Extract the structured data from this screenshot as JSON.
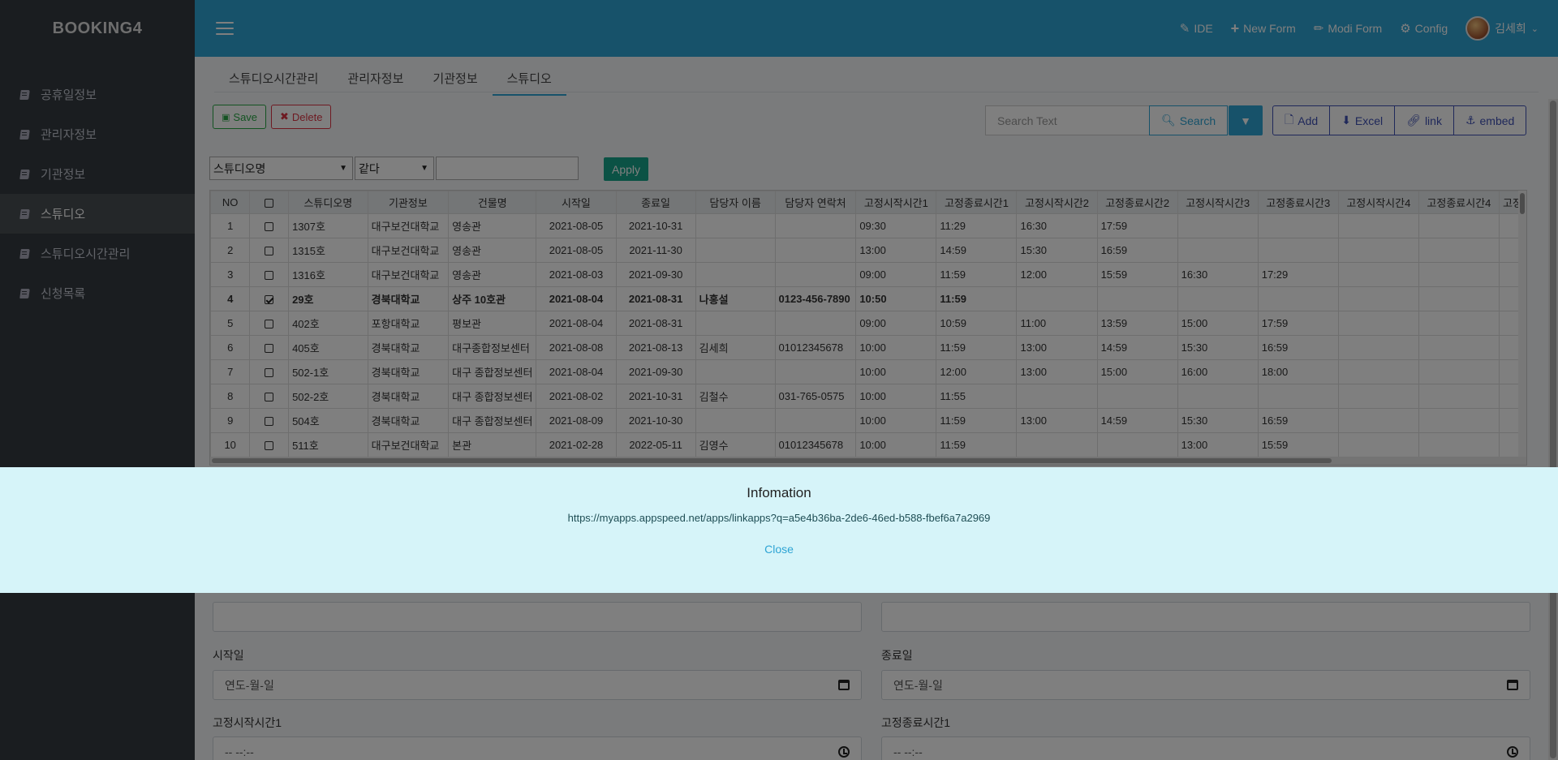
{
  "brand": "BOOKING4",
  "sidebar": {
    "items": [
      {
        "label": "공휴일정보",
        "active": false
      },
      {
        "label": "관리자정보",
        "active": false
      },
      {
        "label": "기관정보",
        "active": false
      },
      {
        "label": "스튜디오",
        "active": true
      },
      {
        "label": "스튜디오시간관리",
        "active": false
      },
      {
        "label": "신청목록",
        "active": false
      }
    ]
  },
  "topbar": {
    "ide": "IDE",
    "new_form": "New Form",
    "modi_form": "Modi Form",
    "config": "Config",
    "user": "김세희"
  },
  "tabs": [
    "스튜디오시간관리",
    "관리자정보",
    "기관정보",
    "스튜디오"
  ],
  "toolbar": {
    "save": "Save",
    "delete": "Delete",
    "search_placeholder": "Search Text",
    "search": "Search",
    "add": "Add",
    "excel": "Excel",
    "link": "link",
    "embed": "embed"
  },
  "filter": {
    "field": "스튜디오명",
    "operator": "같다",
    "apply": "Apply"
  },
  "grid": {
    "columns": [
      "NO",
      "",
      "스튜디오명",
      "기관정보",
      "건물명",
      "시작일",
      "종료일",
      "담당자 이름",
      "담당자 연락처",
      "고정시작시간1",
      "고정종료시간1",
      "고정시작시간2",
      "고정종료시간2",
      "고정시작시간3",
      "고정종료시간3",
      "고정시작시간4",
      "고정종료시간4",
      "고정"
    ],
    "rows": [
      {
        "no": "1",
        "checked": false,
        "studio": "1307호",
        "org": "대구보건대학교",
        "bldg": "영송관",
        "start": "2021-08-05",
        "end": "2021-10-31",
        "mgr": "",
        "phone": "",
        "s1": "09:30",
        "e1": "11:29",
        "s2": "16:30",
        "e2": "17:59",
        "s3": "",
        "e3": "",
        "s4": "",
        "e4": ""
      },
      {
        "no": "2",
        "checked": false,
        "studio": "1315호",
        "org": "대구보건대학교",
        "bldg": "영송관",
        "start": "2021-08-05",
        "end": "2021-11-30",
        "mgr": "",
        "phone": "",
        "s1": "13:00",
        "e1": "14:59",
        "s2": "15:30",
        "e2": "16:59",
        "s3": "",
        "e3": "",
        "s4": "",
        "e4": ""
      },
      {
        "no": "3",
        "checked": false,
        "studio": "1316호",
        "org": "대구보건대학교",
        "bldg": "영송관",
        "start": "2021-08-03",
        "end": "2021-09-30",
        "mgr": "",
        "phone": "",
        "s1": "09:00",
        "e1": "11:59",
        "s2": "12:00",
        "e2": "15:59",
        "s3": "16:30",
        "e3": "17:29",
        "s4": "",
        "e4": ""
      },
      {
        "no": "4",
        "checked": true,
        "studio": "29호",
        "org": "경북대학교",
        "bldg": "상주 10호관",
        "start": "2021-08-04",
        "end": "2021-08-31",
        "mgr": "나홍설",
        "phone": "0123-456-7890",
        "s1": "10:50",
        "e1": "11:59",
        "s2": "",
        "e2": "",
        "s3": "",
        "e3": "",
        "s4": "",
        "e4": ""
      },
      {
        "no": "5",
        "checked": false,
        "studio": "402호",
        "org": "포항대학교",
        "bldg": "평보관",
        "start": "2021-08-04",
        "end": "2021-08-31",
        "mgr": "",
        "phone": "",
        "s1": "09:00",
        "e1": "10:59",
        "s2": "11:00",
        "e2": "13:59",
        "s3": "15:00",
        "e3": "17:59",
        "s4": "",
        "e4": ""
      },
      {
        "no": "6",
        "checked": false,
        "studio": "405호",
        "org": "경북대학교",
        "bldg": "대구종합정보센터",
        "start": "2021-08-08",
        "end": "2021-08-13",
        "mgr": "김세희",
        "phone": "01012345678",
        "s1": "10:00",
        "e1": "11:59",
        "s2": "13:00",
        "e2": "14:59",
        "s3": "15:30",
        "e3": "16:59",
        "s4": "",
        "e4": ""
      },
      {
        "no": "7",
        "checked": false,
        "studio": "502-1호",
        "org": "경북대학교",
        "bldg": "대구 종합정보센터",
        "start": "2021-08-04",
        "end": "2021-09-30",
        "mgr": "",
        "phone": "",
        "s1": "10:00",
        "e1": "12:00",
        "s2": "13:00",
        "e2": "15:00",
        "s3": "16:00",
        "e3": "18:00",
        "s4": "",
        "e4": ""
      },
      {
        "no": "8",
        "checked": false,
        "studio": "502-2호",
        "org": "경북대학교",
        "bldg": "대구 종합정보센터",
        "start": "2021-08-02",
        "end": "2021-10-31",
        "mgr": "김철수",
        "phone": "031-765-0575",
        "s1": "10:00",
        "e1": "11:55",
        "s2": "",
        "e2": "",
        "s3": "",
        "e3": "",
        "s4": "",
        "e4": ""
      },
      {
        "no": "9",
        "checked": false,
        "studio": "504호",
        "org": "경북대학교",
        "bldg": "대구 종합정보센터",
        "start": "2021-08-09",
        "end": "2021-10-30",
        "mgr": "",
        "phone": "",
        "s1": "10:00",
        "e1": "11:59",
        "s2": "13:00",
        "e2": "14:59",
        "s3": "15:30",
        "e3": "16:59",
        "s4": "",
        "e4": ""
      },
      {
        "no": "10",
        "checked": false,
        "studio": "511호",
        "org": "대구보건대학교",
        "bldg": "본관",
        "start": "2021-02-28",
        "end": "2022-05-11",
        "mgr": "김영수",
        "phone": "01012345678",
        "s1": "10:00",
        "e1": "11:59",
        "s2": "",
        "e2": "",
        "s3": "13:00",
        "e3": "15:59",
        "s4": "",
        "e4": ""
      }
    ]
  },
  "form": {
    "start_date_label": "시작일",
    "end_date_label": "종료일",
    "date_placeholder": "연도-월-일",
    "fixed_start1_label": "고정시작시간1",
    "fixed_end1_label": "고정종료시간1",
    "time_placeholder": "-- --:--"
  },
  "modal": {
    "title": "Infomation",
    "url": "https://myapps.appspeed.net/apps/linkapps?q=a5e4b36ba-2de6-46ed-b588-fbef6a7a2969",
    "close": "Close"
  }
}
